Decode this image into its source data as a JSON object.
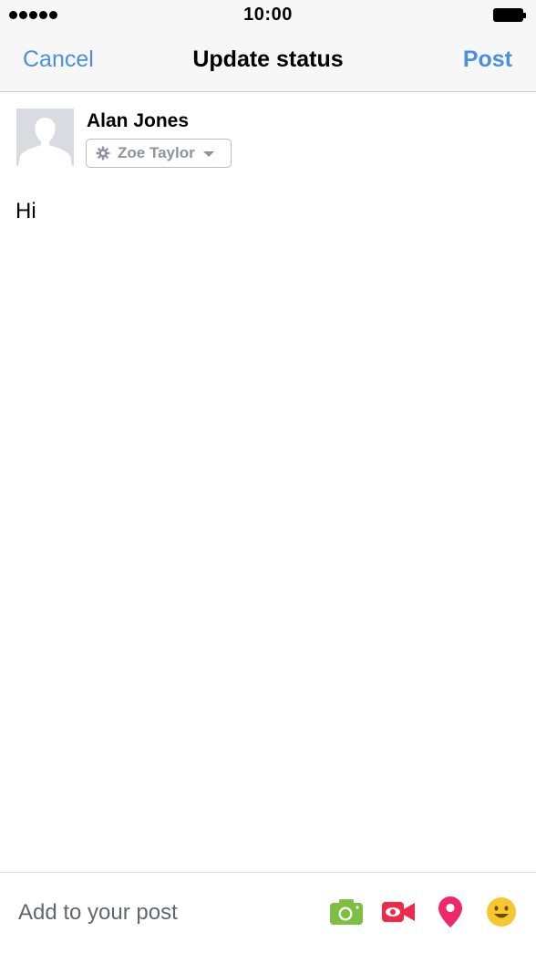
{
  "status_bar": {
    "time": "10:00",
    "signal_bars": 5
  },
  "nav": {
    "cancel_label": "Cancel",
    "title": "Update status",
    "post_label": "Post"
  },
  "composer": {
    "author_name": "Alan Jones",
    "audience_label": "Zoe Taylor",
    "post_text": "Hi"
  },
  "bottom_bar": {
    "add_label": "Add to your post",
    "tools": [
      {
        "name": "camera-icon",
        "color": "#7cbf43"
      },
      {
        "name": "video-icon",
        "color": "#f02849"
      },
      {
        "name": "location-pin-icon",
        "color": "#f0286a"
      },
      {
        "name": "smiley-icon",
        "color": "#f7c72d"
      }
    ]
  },
  "colors": {
    "accent": "#4a90e2",
    "bar_bg": "#f7f7f7",
    "muted_text": "#8d949e"
  }
}
